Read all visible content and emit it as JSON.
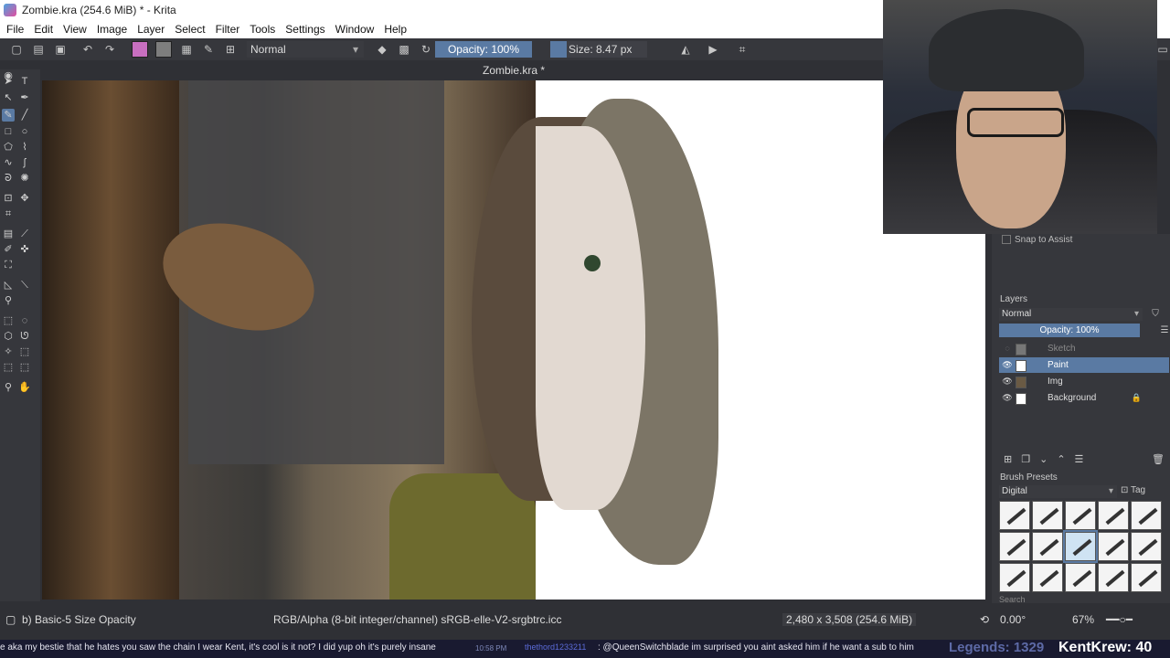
{
  "window": {
    "title": "Zombie.kra (254.6 MiB)  * - Krita",
    "controls": [
      "–",
      "❐",
      "✕"
    ]
  },
  "menu": [
    "File",
    "Edit",
    "View",
    "Image",
    "Layer",
    "Select",
    "Filter",
    "Tools",
    "Settings",
    "Window",
    "Help"
  ],
  "toolbar": {
    "blend_mode": "Normal",
    "opacity": "Opacity: 100%",
    "size": "Size: 8.47 px",
    "fg_color": "#c86fc0",
    "bg_color": "#7e7e7e"
  },
  "document_tab": "Zombie.kra *",
  "dockers": {
    "snap": "Snap to Assist",
    "layers_title": "Layers",
    "layers_blend": "Normal",
    "layers_opacity": "Opacity:  100%",
    "layers": [
      {
        "name": "Sketch",
        "visible": false,
        "locked": false
      },
      {
        "name": "Paint",
        "visible": true,
        "locked": false,
        "active": true
      },
      {
        "name": "Img",
        "visible": true,
        "locked": false
      },
      {
        "name": "Background",
        "visible": true,
        "locked": true
      }
    ],
    "brush_presets_title": "Brush Presets",
    "brush_presets_filter": "Digital",
    "tag_label": "Tag",
    "search_placeholder": "Search"
  },
  "status": {
    "brush": "b) Basic-5 Size Opacity",
    "color_space": "RGB/Alpha (8-bit integer/channel)  sRGB-elle-V2-srgbtrc.icc",
    "dimensions": "2,480 x 3,508 (254.6 MiB)",
    "rotation": "0.00°",
    "zoom": "67%"
  },
  "chat": {
    "message_1": "e aka my bestie that he hates  you saw the chain I wear Kent, it's cool is it not?  I did  yup  oh it's purely insane",
    "time": "10:58 PM",
    "user": "thethord1233211",
    "message_2": ": @QueenSwitchblade im surprised you aint asked him if he want a sub to him",
    "legends": "Legends: 1329",
    "ticker": "KentKrew: 40"
  }
}
